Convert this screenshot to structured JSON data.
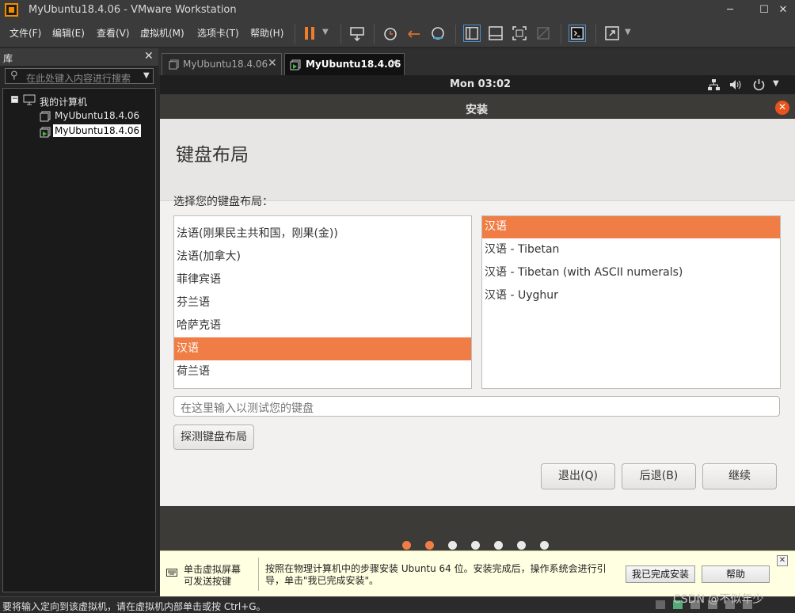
{
  "window": {
    "title": "MyUbuntu18.4.06 - VMware Workstation"
  },
  "menu": [
    "文件(F)",
    "编辑(E)",
    "查看(V)",
    "虚拟机(M)",
    "选项卡(T)",
    "帮助(H)"
  ],
  "library": {
    "title": "库",
    "search_placeholder": "在此处键入内容进行搜索",
    "tree_root": "我的计算机",
    "vms": [
      "MyUbuntu18.4.06",
      "MyUbuntu18.4.06"
    ]
  },
  "tabs": [
    {
      "label": "MyUbuntu18.4.06",
      "active": false
    },
    {
      "label": "MyUbuntu18.4.06",
      "active": true
    }
  ],
  "gnome": {
    "clock": "Mon 03:02"
  },
  "installer": {
    "dialog_title": "安装",
    "heading": "键盘布局",
    "prompt": "选择您的键盘布局：",
    "languages": [
      {
        "label": "法语(刚果民主共和国，刚果(金))",
        "selected": false
      },
      {
        "label": "法语(加拿大)",
        "selected": false
      },
      {
        "label": "菲律宾语",
        "selected": false
      },
      {
        "label": "芬兰语",
        "selected": false
      },
      {
        "label": "哈萨克语",
        "selected": false
      },
      {
        "label": "汉语",
        "selected": true
      },
      {
        "label": "荷兰语",
        "selected": false
      }
    ],
    "variants": [
      {
        "label": "汉语",
        "selected": true
      },
      {
        "label": "汉语 - Tibetan",
        "selected": false
      },
      {
        "label": "汉语 - Tibetan (with ASCII numerals)",
        "selected": false
      },
      {
        "label": "汉语 - Uyghur",
        "selected": false
      }
    ],
    "test_placeholder": "在这里输入以测试您的键盘",
    "detect_button": "探测键盘布局",
    "quit_button": "退出(Q)",
    "back_button": "后退(B)",
    "continue_button": "继续",
    "progress": {
      "steps": 7,
      "completed": 2
    }
  },
  "hint": {
    "left_text": "单击虚拟屏幕\n可发送按键",
    "main_text": "按照在物理计算机中的步骤安装 Ubuntu 64 位。安装完成后，操作系统会进行引导，单击\"我已完成安装\"。",
    "done_button": "我已完成安装",
    "help_button": "帮助"
  },
  "status": {
    "text": "要将输入定向到该虚拟机，请在虚拟机内部单击或按 Ctrl+G。"
  },
  "watermark": "CSDN @不似年少",
  "colors": {
    "accent": "#f07d45",
    "dark_bg": "#262626",
    "dialog_bg": "#f2f1f0"
  }
}
